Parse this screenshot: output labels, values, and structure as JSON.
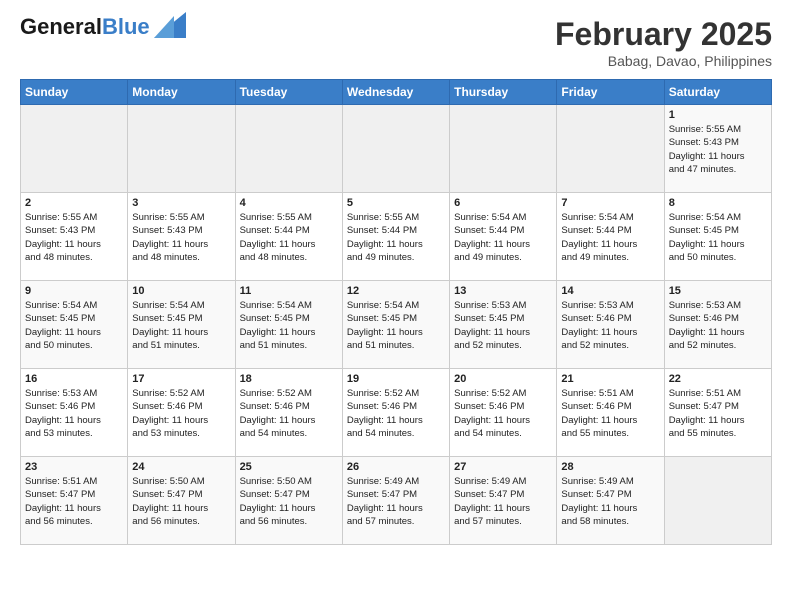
{
  "logo": {
    "line1": "General",
    "line2": "Blue"
  },
  "title": "February 2025",
  "location": "Babag, Davao, Philippines",
  "weekdays": [
    "Sunday",
    "Monday",
    "Tuesday",
    "Wednesday",
    "Thursday",
    "Friday",
    "Saturday"
  ],
  "weeks": [
    [
      {
        "day": "",
        "info": ""
      },
      {
        "day": "",
        "info": ""
      },
      {
        "day": "",
        "info": ""
      },
      {
        "day": "",
        "info": ""
      },
      {
        "day": "",
        "info": ""
      },
      {
        "day": "",
        "info": ""
      },
      {
        "day": "1",
        "info": "Sunrise: 5:55 AM\nSunset: 5:43 PM\nDaylight: 11 hours\nand 47 minutes."
      }
    ],
    [
      {
        "day": "2",
        "info": "Sunrise: 5:55 AM\nSunset: 5:43 PM\nDaylight: 11 hours\nand 48 minutes."
      },
      {
        "day": "3",
        "info": "Sunrise: 5:55 AM\nSunset: 5:43 PM\nDaylight: 11 hours\nand 48 minutes."
      },
      {
        "day": "4",
        "info": "Sunrise: 5:55 AM\nSunset: 5:44 PM\nDaylight: 11 hours\nand 48 minutes."
      },
      {
        "day": "5",
        "info": "Sunrise: 5:55 AM\nSunset: 5:44 PM\nDaylight: 11 hours\nand 49 minutes."
      },
      {
        "day": "6",
        "info": "Sunrise: 5:54 AM\nSunset: 5:44 PM\nDaylight: 11 hours\nand 49 minutes."
      },
      {
        "day": "7",
        "info": "Sunrise: 5:54 AM\nSunset: 5:44 PM\nDaylight: 11 hours\nand 49 minutes."
      },
      {
        "day": "8",
        "info": "Sunrise: 5:54 AM\nSunset: 5:45 PM\nDaylight: 11 hours\nand 50 minutes."
      }
    ],
    [
      {
        "day": "9",
        "info": "Sunrise: 5:54 AM\nSunset: 5:45 PM\nDaylight: 11 hours\nand 50 minutes."
      },
      {
        "day": "10",
        "info": "Sunrise: 5:54 AM\nSunset: 5:45 PM\nDaylight: 11 hours\nand 51 minutes."
      },
      {
        "day": "11",
        "info": "Sunrise: 5:54 AM\nSunset: 5:45 PM\nDaylight: 11 hours\nand 51 minutes."
      },
      {
        "day": "12",
        "info": "Sunrise: 5:54 AM\nSunset: 5:45 PM\nDaylight: 11 hours\nand 51 minutes."
      },
      {
        "day": "13",
        "info": "Sunrise: 5:53 AM\nSunset: 5:45 PM\nDaylight: 11 hours\nand 52 minutes."
      },
      {
        "day": "14",
        "info": "Sunrise: 5:53 AM\nSunset: 5:46 PM\nDaylight: 11 hours\nand 52 minutes."
      },
      {
        "day": "15",
        "info": "Sunrise: 5:53 AM\nSunset: 5:46 PM\nDaylight: 11 hours\nand 52 minutes."
      }
    ],
    [
      {
        "day": "16",
        "info": "Sunrise: 5:53 AM\nSunset: 5:46 PM\nDaylight: 11 hours\nand 53 minutes."
      },
      {
        "day": "17",
        "info": "Sunrise: 5:52 AM\nSunset: 5:46 PM\nDaylight: 11 hours\nand 53 minutes."
      },
      {
        "day": "18",
        "info": "Sunrise: 5:52 AM\nSunset: 5:46 PM\nDaylight: 11 hours\nand 54 minutes."
      },
      {
        "day": "19",
        "info": "Sunrise: 5:52 AM\nSunset: 5:46 PM\nDaylight: 11 hours\nand 54 minutes."
      },
      {
        "day": "20",
        "info": "Sunrise: 5:52 AM\nSunset: 5:46 PM\nDaylight: 11 hours\nand 54 minutes."
      },
      {
        "day": "21",
        "info": "Sunrise: 5:51 AM\nSunset: 5:46 PM\nDaylight: 11 hours\nand 55 minutes."
      },
      {
        "day": "22",
        "info": "Sunrise: 5:51 AM\nSunset: 5:47 PM\nDaylight: 11 hours\nand 55 minutes."
      }
    ],
    [
      {
        "day": "23",
        "info": "Sunrise: 5:51 AM\nSunset: 5:47 PM\nDaylight: 11 hours\nand 56 minutes."
      },
      {
        "day": "24",
        "info": "Sunrise: 5:50 AM\nSunset: 5:47 PM\nDaylight: 11 hours\nand 56 minutes."
      },
      {
        "day": "25",
        "info": "Sunrise: 5:50 AM\nSunset: 5:47 PM\nDaylight: 11 hours\nand 56 minutes."
      },
      {
        "day": "26",
        "info": "Sunrise: 5:49 AM\nSunset: 5:47 PM\nDaylight: 11 hours\nand 57 minutes."
      },
      {
        "day": "27",
        "info": "Sunrise: 5:49 AM\nSunset: 5:47 PM\nDaylight: 11 hours\nand 57 minutes."
      },
      {
        "day": "28",
        "info": "Sunrise: 5:49 AM\nSunset: 5:47 PM\nDaylight: 11 hours\nand 58 minutes."
      },
      {
        "day": "",
        "info": ""
      }
    ]
  ]
}
